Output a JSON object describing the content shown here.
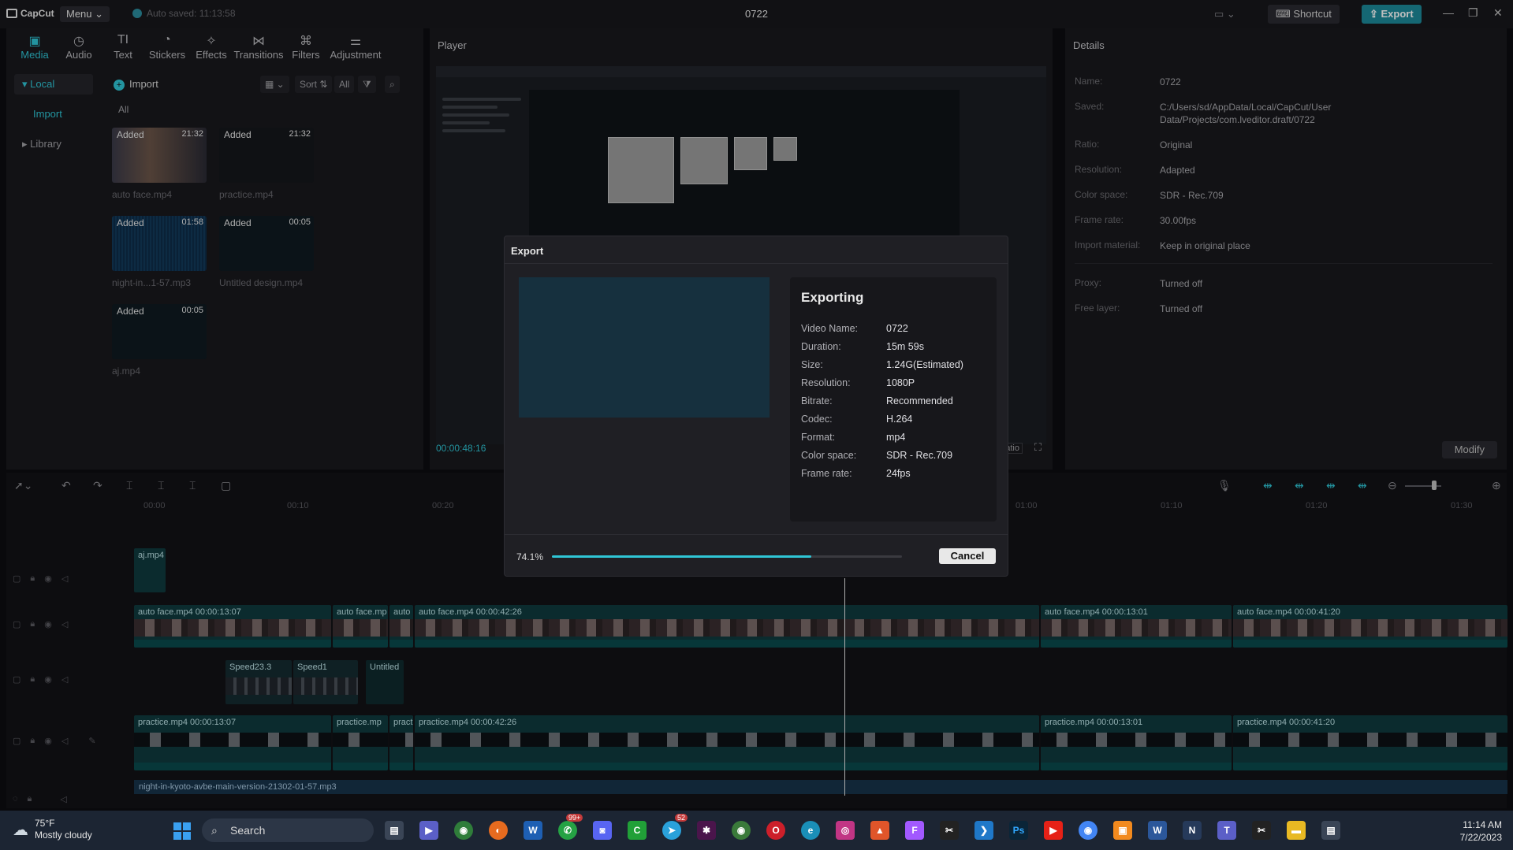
{
  "titlebar": {
    "app_name": "CapCut",
    "menu_label": "Menu",
    "autosave": "Auto saved: 11:13:58",
    "project_title": "0722",
    "shortcut_label": "Shortcut",
    "export_label": "Export"
  },
  "left_panel": {
    "tabs": [
      {
        "label": "Media",
        "icon": "media-icon"
      },
      {
        "label": "Audio",
        "icon": "audio-icon"
      },
      {
        "label": "Text",
        "icon": "text-icon"
      },
      {
        "label": "Stickers",
        "icon": "stickers-icon"
      },
      {
        "label": "Effects",
        "icon": "effects-icon"
      },
      {
        "label": "Transitions",
        "icon": "transitions-icon"
      },
      {
        "label": "Filters",
        "icon": "filters-icon"
      },
      {
        "label": "Adjustment",
        "icon": "adjustment-icon"
      }
    ],
    "side_nav": {
      "local": "Local",
      "import": "Import",
      "library": "Library"
    },
    "import_label": "Import",
    "sort_label": "Sort",
    "all_filter": "All",
    "all_label": "All",
    "media": [
      {
        "name": "auto face.mp4",
        "badge": "Added",
        "duration": "21:32"
      },
      {
        "name": "practice.mp4",
        "badge": "Added",
        "duration": "21:32"
      },
      {
        "name": "night-in...1-57.mp3",
        "badge": "Added",
        "duration": "01:58"
      },
      {
        "name": "Untitled design.mp4",
        "badge": "Added",
        "duration": "00:05"
      },
      {
        "name": "aj.mp4",
        "badge": "Added",
        "duration": "00:05"
      }
    ]
  },
  "player": {
    "title": "Player",
    "timecode": "00:00:48:16",
    "ratio_label": "Ratio"
  },
  "details": {
    "title": "Details",
    "rows": [
      {
        "key": "Name:",
        "value": "0722"
      },
      {
        "key": "Saved:",
        "value": "C:/Users/sd/AppData/Local/CapCut/User Data/Projects/com.lveditor.draft/0722"
      },
      {
        "key": "Ratio:",
        "value": "Original"
      },
      {
        "key": "Resolution:",
        "value": "Adapted"
      },
      {
        "key": "Color space:",
        "value": "SDR - Rec.709"
      },
      {
        "key": "Frame rate:",
        "value": "30.00fps"
      },
      {
        "key": "Import material:",
        "value": "Keep in original place"
      }
    ],
    "rows2": [
      {
        "key": "Proxy:",
        "value": "Turned off"
      },
      {
        "key": "Free layer:",
        "value": "Turned off"
      }
    ],
    "modify_label": "Modify"
  },
  "timeline": {
    "ruler": [
      "00:00",
      "00:10",
      "00:20",
      "01:00",
      "01:10",
      "01:20",
      "01:30"
    ],
    "clips": {
      "aj": "aj.mp4",
      "v1": "auto face.mp4   00:00:13:07",
      "v2": "auto face.mp",
      "v3": "auto",
      "v4": "auto face.mp4   00:00:42:26",
      "v5": "auto face.mp4   00:00:13:01",
      "v6": "auto face.mp4   00:00:41:20",
      "s1": "Speed23.3",
      "s2": "Speed1",
      "u1": "Untitled",
      "p1": "practice.mp4   00:00:13:07",
      "p2": "practice.mp",
      "p3": "pract",
      "p4": "practice.mp4   00:00:42:26",
      "p5": "practice.mp4   00:00:13:01",
      "p6": "practice.mp4   00:00:41:20",
      "audio": "night-in-kyoto-avbe-main-version-21302-01-57.mp3"
    }
  },
  "export_modal": {
    "title": "Export",
    "heading": "Exporting",
    "rows": [
      {
        "key": "Video Name:",
        "value": "0722"
      },
      {
        "key": "Duration:",
        "value": "15m 59s"
      },
      {
        "key": "Size:",
        "value": "1.24G(Estimated)"
      },
      {
        "key": "Resolution:",
        "value": "1080P"
      },
      {
        "key": "Bitrate:",
        "value": "Recommended"
      },
      {
        "key": "Codec:",
        "value": "H.264"
      },
      {
        "key": "Format:",
        "value": "mp4"
      },
      {
        "key": "Color space:",
        "value": "SDR - Rec.709"
      },
      {
        "key": "Frame rate:",
        "value": "24fps"
      }
    ],
    "progress_text": "74.1%",
    "progress": 0.741,
    "cancel_label": "Cancel"
  },
  "taskbar": {
    "temperature": "75°F",
    "weather": "Mostly cloudy",
    "search": "Search",
    "time": "11:14 AM",
    "date": "7/22/2023",
    "badges": {
      "whatsapp": "99+",
      "telegram": "52"
    }
  },
  "colors": {
    "accent": "#2fc6d6",
    "export_button": "#1d8a9a"
  }
}
